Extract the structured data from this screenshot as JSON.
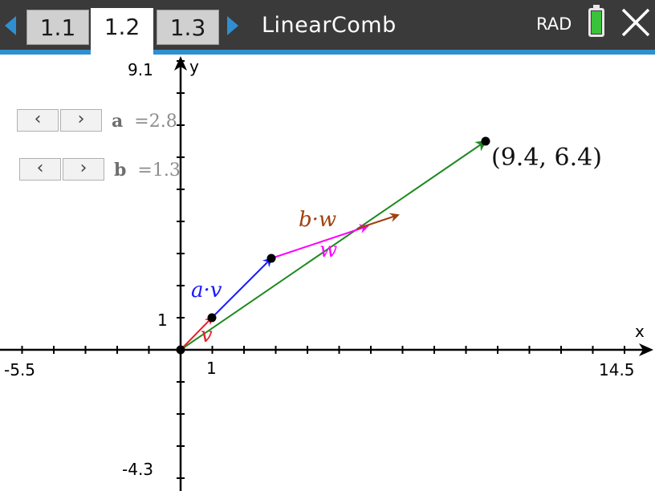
{
  "tabs": [
    {
      "label": "1.1",
      "active": false
    },
    {
      "label": "1.2",
      "active": true
    },
    {
      "label": "1.3",
      "active": false
    }
  ],
  "document_title": "LinearComb",
  "angle_mode": "RAD",
  "graph": {
    "window": {
      "x_min_label": "-5.5",
      "x_max_label": "14.5",
      "y_max_label": "9.1",
      "y_min_label": "-4.3",
      "x_tick_label": "1",
      "y_tick_label": "1"
    },
    "axis_labels": {
      "x": "x",
      "y": "y"
    },
    "sliders": [
      {
        "name": "a",
        "value_text": "=2.8",
        "value": 2.8
      },
      {
        "name": "b",
        "value_text": "=1.3",
        "value": 1.3
      }
    ],
    "vectors": {
      "v": {
        "label": "v",
        "color": "#e8202a",
        "x": 1,
        "y": 1
      },
      "w": {
        "label": "w",
        "color": "#ff00ff",
        "x": 3,
        "y": 1
      },
      "a_v": {
        "label": "a·v",
        "color": "#1a1aff"
      },
      "b_w": {
        "label": "b·w",
        "color": "#a0400c"
      },
      "sum": {
        "color": "#1f8a1f"
      }
    },
    "result_point_label": "(9.4, 6.4)",
    "point_color": "#000000"
  },
  "colors": {
    "topbar": "#3a3a3a",
    "accent": "#2f8fd0",
    "battery": "#39c23a"
  }
}
